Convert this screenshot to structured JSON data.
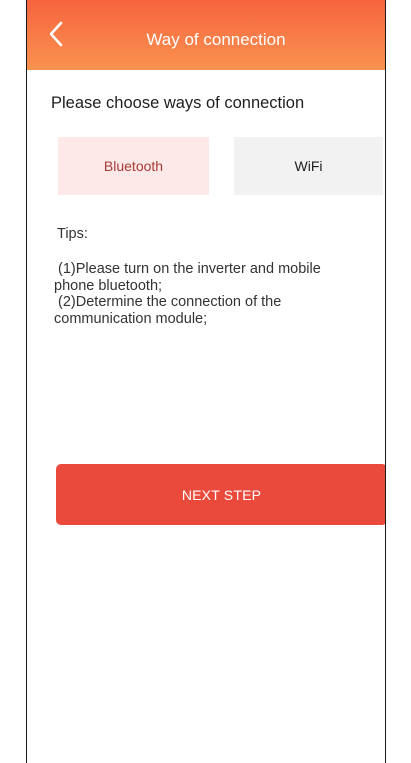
{
  "header": {
    "title": "Way of connection",
    "back_icon": "chevron-left-icon",
    "gradient_start": "#f7643f",
    "gradient_end": "#f8924f"
  },
  "main": {
    "heading": "Please choose ways of connection",
    "options": [
      {
        "label": "Bluetooth",
        "selected": true
      },
      {
        "label": "WiFi",
        "selected": false
      }
    ],
    "tips_title": "Tips:",
    "tips": [
      " (1)Please turn on the inverter and mobile phone bluetooth;",
      " (2)Determine the connection of the communication module;"
    ],
    "next_label": "NEXT STEP"
  },
  "colors": {
    "accent": "#ea4a3c",
    "selected_bg": "#fde9e7",
    "selected_text": "#a83a35",
    "unselected_bg": "#f2f2f2"
  }
}
